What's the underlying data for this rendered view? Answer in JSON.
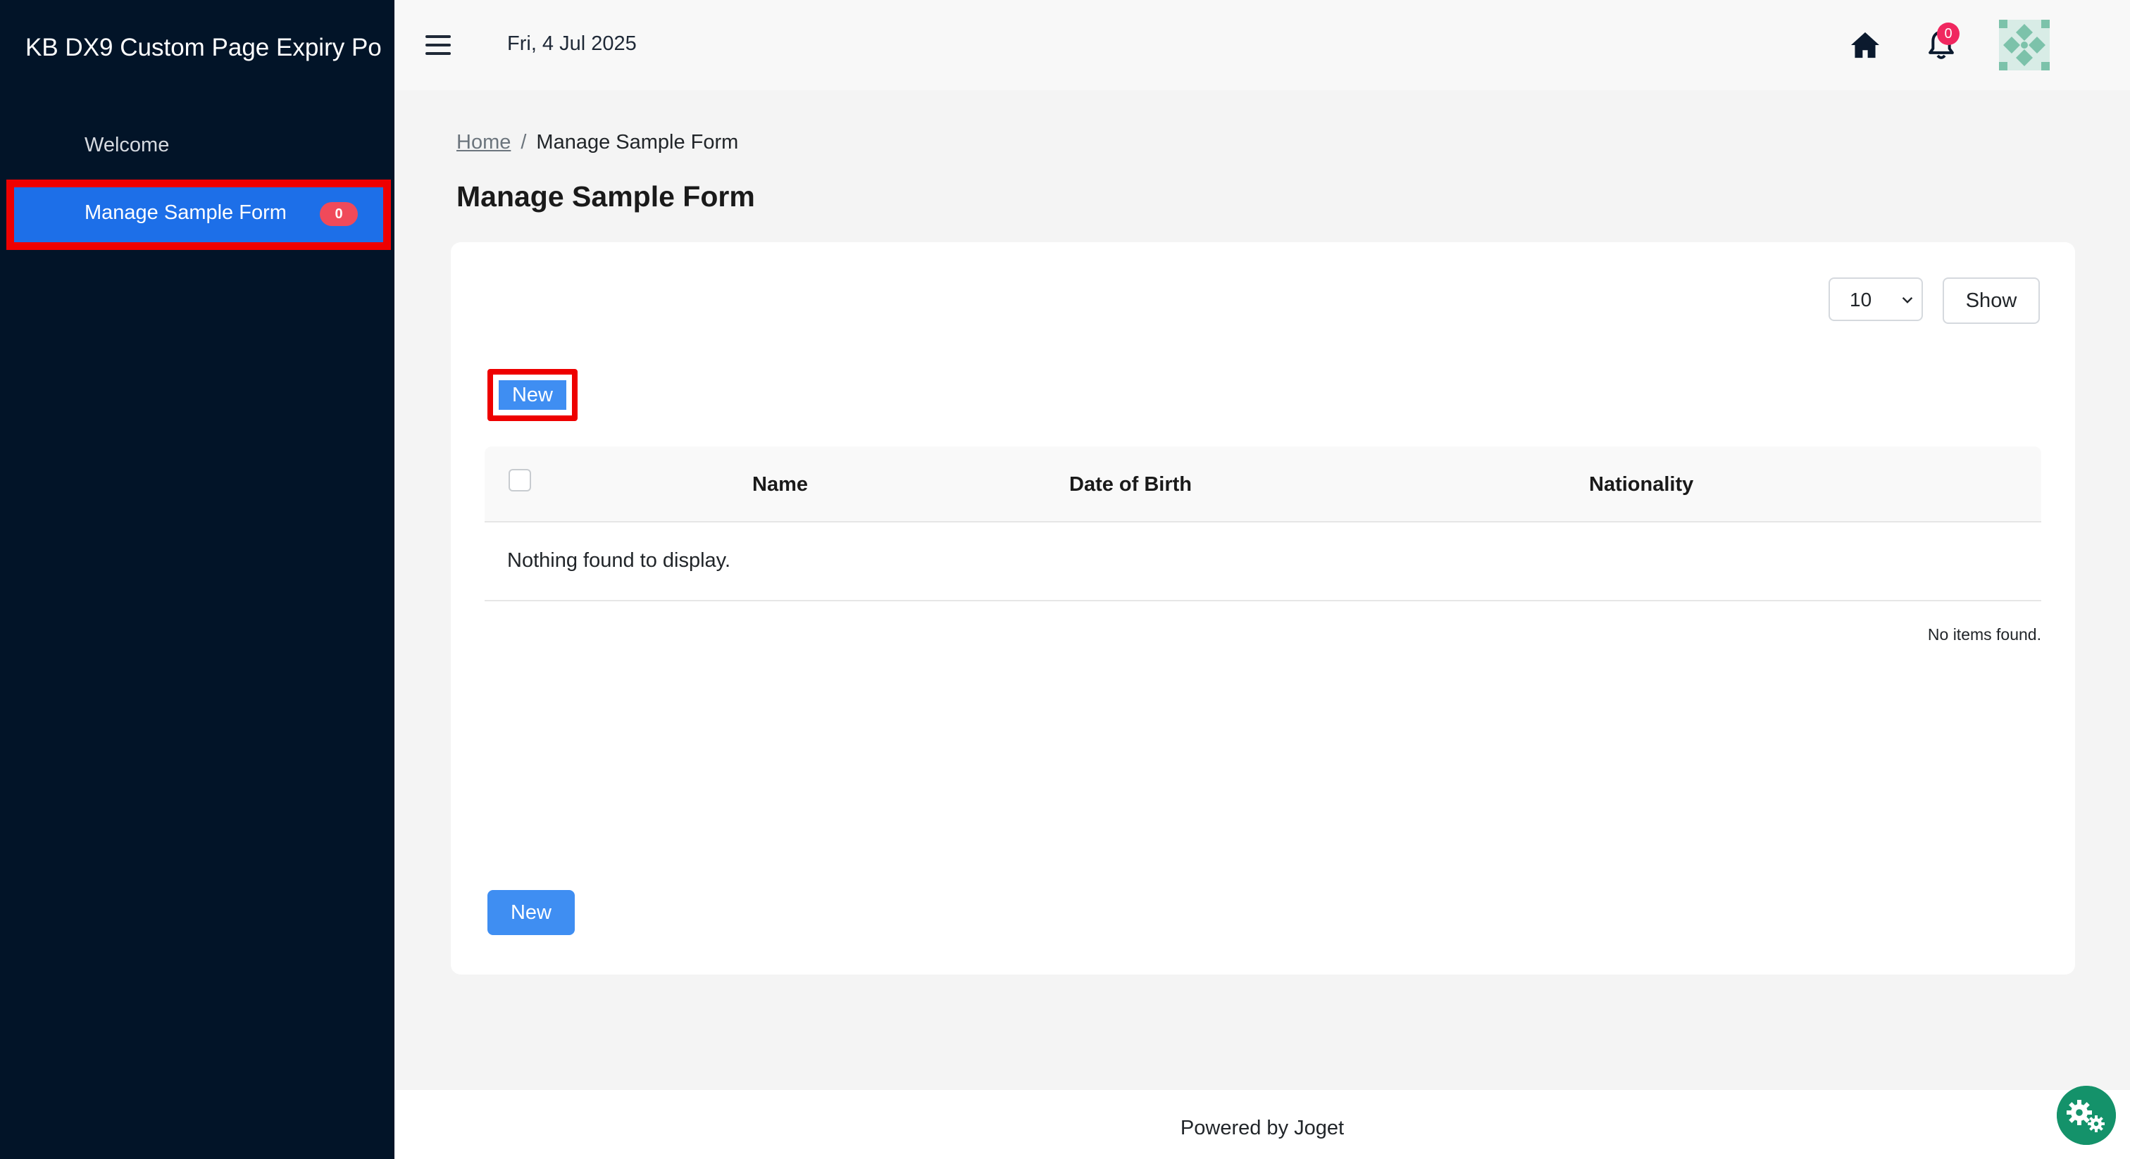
{
  "sidebar": {
    "app_title": "KB DX9 Custom Page Expiry Po",
    "items": [
      {
        "label": "Welcome"
      },
      {
        "label": "Manage Sample Form",
        "badge": "0"
      }
    ]
  },
  "header": {
    "date": "Fri, 4 Jul 2025",
    "notification_count": "0",
    "icons": [
      "menu-icon",
      "home-icon",
      "bell-icon",
      "avatar"
    ]
  },
  "breadcrumb": {
    "home": "Home",
    "separator": "/",
    "current": "Manage Sample Form"
  },
  "page": {
    "title": "Manage Sample Form"
  },
  "list": {
    "page_size": "10",
    "show_label": "Show",
    "new_label": "New",
    "columns": [
      "Name",
      "Date of Birth",
      "Nationality"
    ],
    "empty_message": "Nothing found to display.",
    "status": "No items found."
  },
  "footer": {
    "text": "Powered by Joget"
  },
  "colors": {
    "sidebar_bg": "#021428",
    "active_item": "#1d6fe8",
    "primary_button": "#3f8ef2",
    "highlight": "#ee0000",
    "badge": "#f04a5a",
    "fab": "#14926a"
  }
}
